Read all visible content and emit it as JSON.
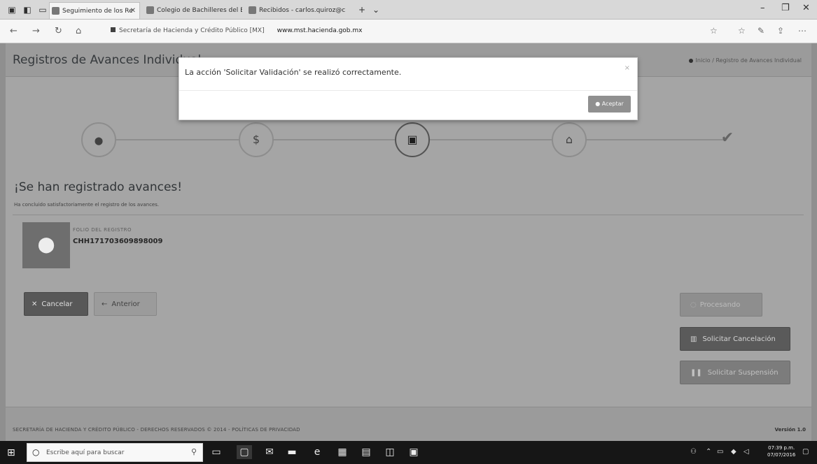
{
  "browser": {
    "tabs": [
      {
        "label": "Seguimiento de los Re",
        "active": true
      },
      {
        "label": "Colegio de Bachilleres del E",
        "active": false
      },
      {
        "label": "Recibidos - carlos.quiroz@c",
        "active": false
      }
    ],
    "new_tab": "+",
    "tab_menu": "⌄",
    "window_controls": {
      "minimize": "–",
      "restore": "❐",
      "close": "✕"
    },
    "address": {
      "site_name": "Secretaría de Hacienda y Crédito Público [MX]",
      "domain": "www.mst.hacienda.gob.mx"
    },
    "toolbar_icons": [
      "star-icon",
      "favorites-icon",
      "reading-icon",
      "share-icon",
      "more-icon"
    ]
  },
  "page": {
    "title": "Registros de Avances Individual",
    "breadcrumb": "Inicio  /  Registro de Avances Individual",
    "steps": [
      {
        "icon": "map-marker-icon",
        "glyph": "⬤"
      },
      {
        "icon": "dollar-icon",
        "glyph": "$"
      },
      {
        "icon": "document-icon",
        "glyph": "▣"
      },
      {
        "icon": "building-icon",
        "glyph": "⌂"
      },
      {
        "icon": "check-icon",
        "glyph": "✔"
      }
    ],
    "success": {
      "title": "¡Se han registrado avances!",
      "subtitle": "Ha concluido satisfactoriamente el registro de los avances."
    },
    "folio": {
      "label": "FOLIO DEL REGISTRO",
      "value": "CHH171703609898009"
    },
    "buttons": {
      "cancel": "Cancelar",
      "previous": "Anterior",
      "process": "Procesando",
      "request_cancellation": "Solicitar Cancelación",
      "request_suspension": "Solicitar Suspensión"
    },
    "footer": {
      "text": "SECRETARÍA DE HACIENDA Y CRÉDITO PÚBLICO - DERECHOS RESERVADOS © 2014 - POLÍTICAS DE PRIVACIDAD",
      "version": "Versión 1.0"
    }
  },
  "modal": {
    "message": "La acción 'Solicitar Validación' se realizó correctamente.",
    "close": "×",
    "accept_label": "Aceptar"
  },
  "taskbar": {
    "search_placeholder": "Escribe aquí para buscar",
    "clock_time": "07:39 p.m.",
    "clock_date": "07/07/2016"
  }
}
